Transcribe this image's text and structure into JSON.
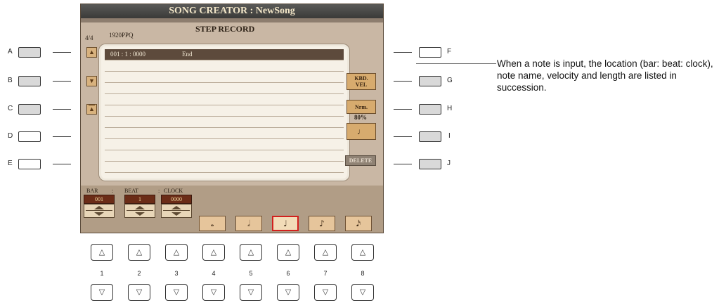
{
  "window": {
    "title": "SONG CREATOR : NewSong",
    "time_signature": "4/4",
    "resolution": "1920PPQ",
    "heading": "STEP RECORD"
  },
  "side_buttons": {
    "left": [
      "A",
      "B",
      "C",
      "D",
      "E"
    ],
    "right": [
      "F",
      "G",
      "H",
      "I",
      "J"
    ]
  },
  "scroll": {
    "up_icon": "triangle-up",
    "down_icon": "triangle-down",
    "top_icon": "triangle-up-bar"
  },
  "event_list": {
    "first_row": {
      "location": "001 : 1 : 0000",
      "event": "End"
    },
    "rows_total": 11
  },
  "right_panel": {
    "kbd_vel_line1": "KBD.",
    "kbd_vel_line2": "VEL",
    "nrm_label": "Nrm.",
    "nrm_value": "80%",
    "note_icon": "quarter-note",
    "delete_label": "DELETE"
  },
  "position": {
    "bar_label": "BAR",
    "beat_label": "BEAT",
    "clock_label": "CLOCK",
    "separator": ":",
    "bar_value": "001",
    "beat_value": "1",
    "clock_value": "0000"
  },
  "note_lengths": [
    {
      "glyph": "𝅝",
      "name": "whole-note"
    },
    {
      "glyph": "𝅗𝅥",
      "name": "half-note"
    },
    {
      "glyph": "♩",
      "name": "quarter-note"
    },
    {
      "glyph": "♪",
      "name": "eighth-note"
    },
    {
      "glyph": "𝅘𝅥𝅯",
      "name": "sixteenth-note"
    }
  ],
  "selected_note_index": 2,
  "hardware_buttons": {
    "numbers": [
      "1",
      "2",
      "3",
      "4",
      "5",
      "6",
      "7",
      "8"
    ],
    "up_glyph": "△",
    "down_glyph": "▽"
  },
  "annotation": "When a note is input, the location (bar: beat: clock), note name, velocity and length are listed in succession.",
  "colors": {
    "screen_bg": "#c9b7a4",
    "titlebar": "#3f3f3d",
    "selected_row": "#5d4a3c",
    "value_box": "#6b2c17",
    "selected_note_border": "#d2201d"
  }
}
